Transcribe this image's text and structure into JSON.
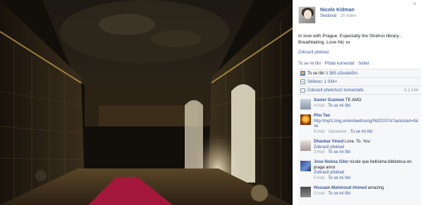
{
  "post": {
    "author": "Nicole Kidman",
    "follow_label": "Sledovat",
    "date": "20 leden",
    "text": "In love with Prague. Especially the Strahov library... Breathtaking. Love Nic xx",
    "translate_label": "Zobrazit překlad",
    "actions": {
      "like": "To se mi líbí",
      "comment": "Přidat komentář",
      "share": "Sdílet"
    }
  },
  "close_label": "×",
  "stats": {
    "likes": "To se líbí 3 385 uživatelům.",
    "shares": "Sdíleno: 1 034×",
    "previous_comments": "Zobrazit předchozí komentáře",
    "previous_count": "6 z 144"
  },
  "comments": [
    {
      "name": "Xavier Guzman",
      "text": "TE AMO",
      "time": "4 hod",
      "like": "To se mi líbí"
    },
    {
      "name": "Pho Tao",
      "text": "http://mp3.zing.vn/embed/song/IWZC0I7A?autostart=false",
      "time": "6 hod",
      "edited": "Upraveno",
      "like": "To se mi líbí"
    },
    {
      "name": "Dhankar Vinod",
      "text": "Love. To. You",
      "translate": "Zobrazit překlad",
      "time": "3 hod",
      "like": "To se mi líbí"
    },
    {
      "name": "Jose Noboa Giler",
      "text": "nicole que bellisima biblioteca en praga amor",
      "translate": "Zobrazit překlad",
      "time": "5 hod",
      "like": "To se mi líbí"
    },
    {
      "name": "Hossam Mahmoud Ahmed",
      "text": "amazing",
      "time": "3 hod",
      "like": "To se mi líbí"
    }
  ],
  "colors": {
    "link": "#3b5998",
    "muted": "#9197a3",
    "panel_bg": "#f6f7f9",
    "carpet": "#a3183a"
  }
}
